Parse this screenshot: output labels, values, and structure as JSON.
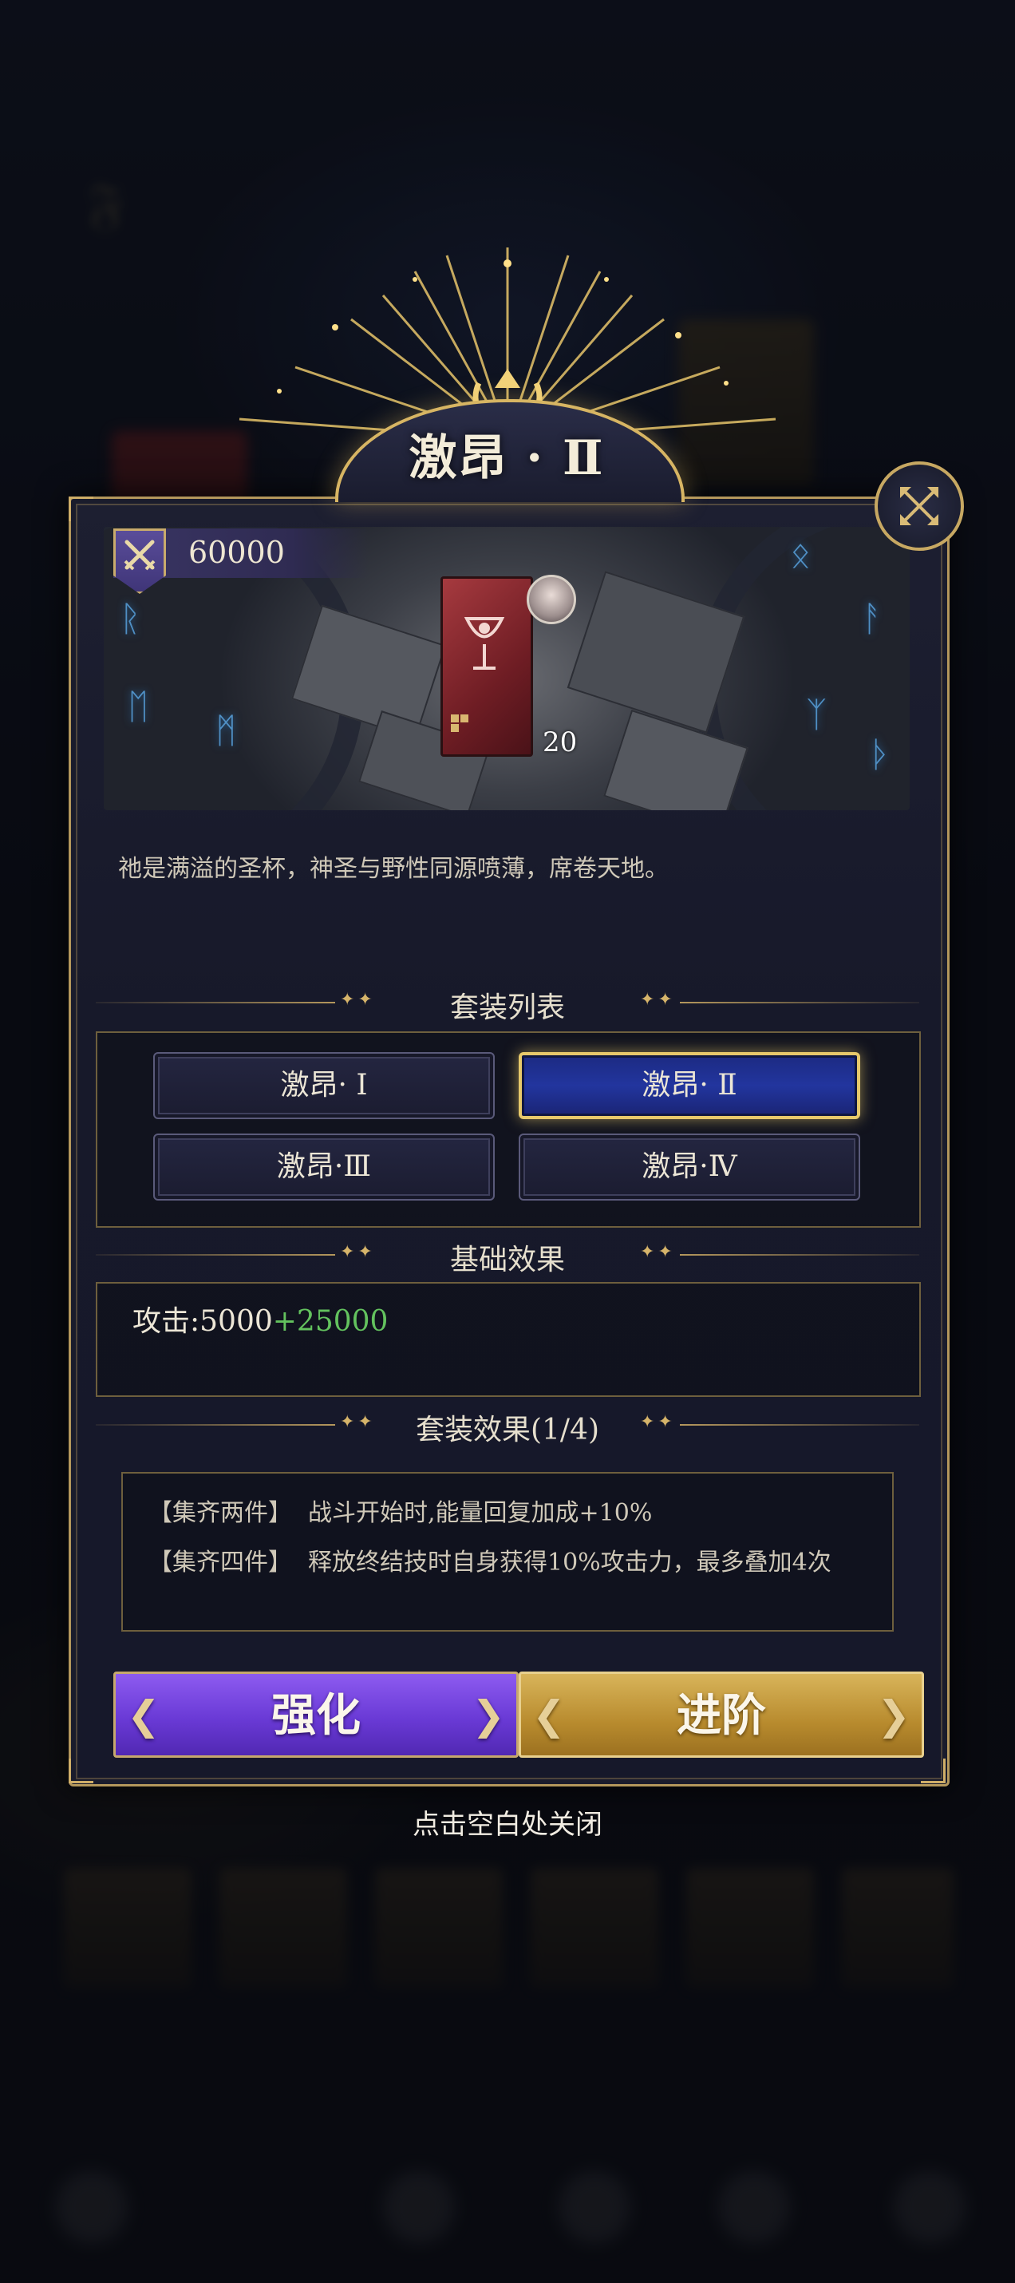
{
  "dialog": {
    "title": "激昂 · Ⅱ",
    "power": "60000",
    "item_count": "20",
    "description": "祂是满溢的圣杯，神圣与野性同源喷薄，席卷天地。"
  },
  "set_list": {
    "header": "套装列表",
    "options": [
      "激昂· Ⅰ",
      "激昂· Ⅱ",
      "激昂·Ⅲ",
      "激昂·Ⅳ"
    ],
    "selected": "激昂· Ⅱ"
  },
  "base_effect": {
    "header": "基础效果",
    "label": "攻击:5000",
    "bonus": "+25000"
  },
  "set_effect": {
    "header": "套装效果(1/4)",
    "lines": [
      {
        "tag": "【集齐两件】",
        "text": "战斗开始时,能量回复加成+10%"
      },
      {
        "tag": "【集齐四件】",
        "text": "释放终结技时自身获得10%攻击力，最多叠加4次"
      }
    ]
  },
  "buttons": {
    "enhance": "强化",
    "advance": "进阶"
  },
  "close_hint": "点击空白处关闭",
  "colors": {
    "gold": "#b4975c",
    "selected_blue": "#22359e",
    "bonus_green": "#63c25e",
    "enhance_purple": "#6a3ad6",
    "advance_gold": "#b88b2e"
  },
  "icons": [
    "close-icon",
    "crossed-swords-icon",
    "chalice-icon"
  ]
}
